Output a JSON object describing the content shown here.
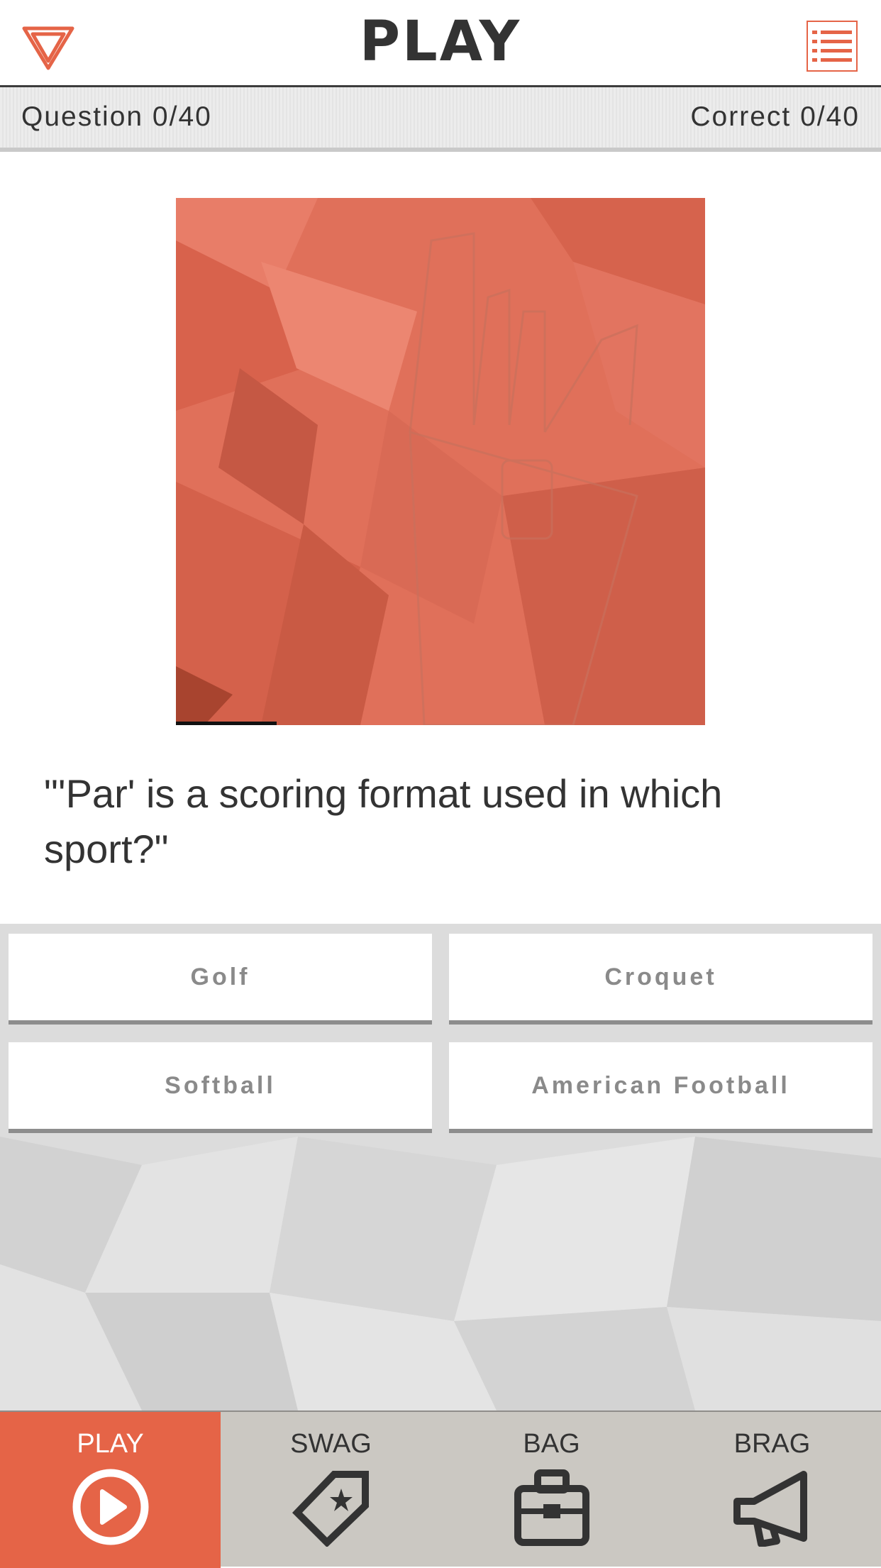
{
  "header": {
    "title": "PLAY",
    "logo_icon": "triangle-logo-icon",
    "menu_icon": "list-menu-icon",
    "accent_color": "#e56447"
  },
  "stats": {
    "question": "Question 0/40",
    "correct": "Correct 0/40"
  },
  "question": {
    "image_icon": "golf-bag-image",
    "timer_progress": 0.19,
    "text": "\"'Par' is a scoring format used in which sport?\""
  },
  "answers": [
    "Golf",
    "Croquet",
    "Softball",
    "American Football"
  ],
  "tabs": [
    {
      "label": "PLAY",
      "icon": "play-circle-icon",
      "active": true
    },
    {
      "label": "SWAG",
      "icon": "tag-star-icon",
      "active": false
    },
    {
      "label": "BAG",
      "icon": "briefcase-icon",
      "active": false
    },
    {
      "label": "BRAG",
      "icon": "megaphone-icon",
      "active": false
    }
  ]
}
